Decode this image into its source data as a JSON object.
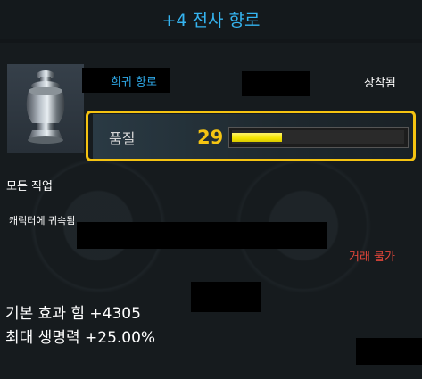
{
  "header": {
    "title": "+4 전사 향로"
  },
  "item": {
    "icon": "incense-burner-icon",
    "grade": "희귀 향로",
    "equipped_label": "장착됨",
    "quality_label": "품질",
    "quality_value": "29",
    "quality_fraction": 0.29,
    "classes": "모든 직업",
    "binding": "캐릭터에 귀속됨",
    "trade": "거래 불가"
  },
  "stats": {
    "base_effect": "기본 효과 힘 +4305",
    "max_hp": "최대 생명력 +25.00%"
  },
  "colors": {
    "title": "#35b4f0",
    "grade": "#2fa9e8",
    "highlight_frame": "#f5c311",
    "quality_value": "#f6c512",
    "bar_fill": "#f4e400",
    "untradable": "#e2463a"
  }
}
